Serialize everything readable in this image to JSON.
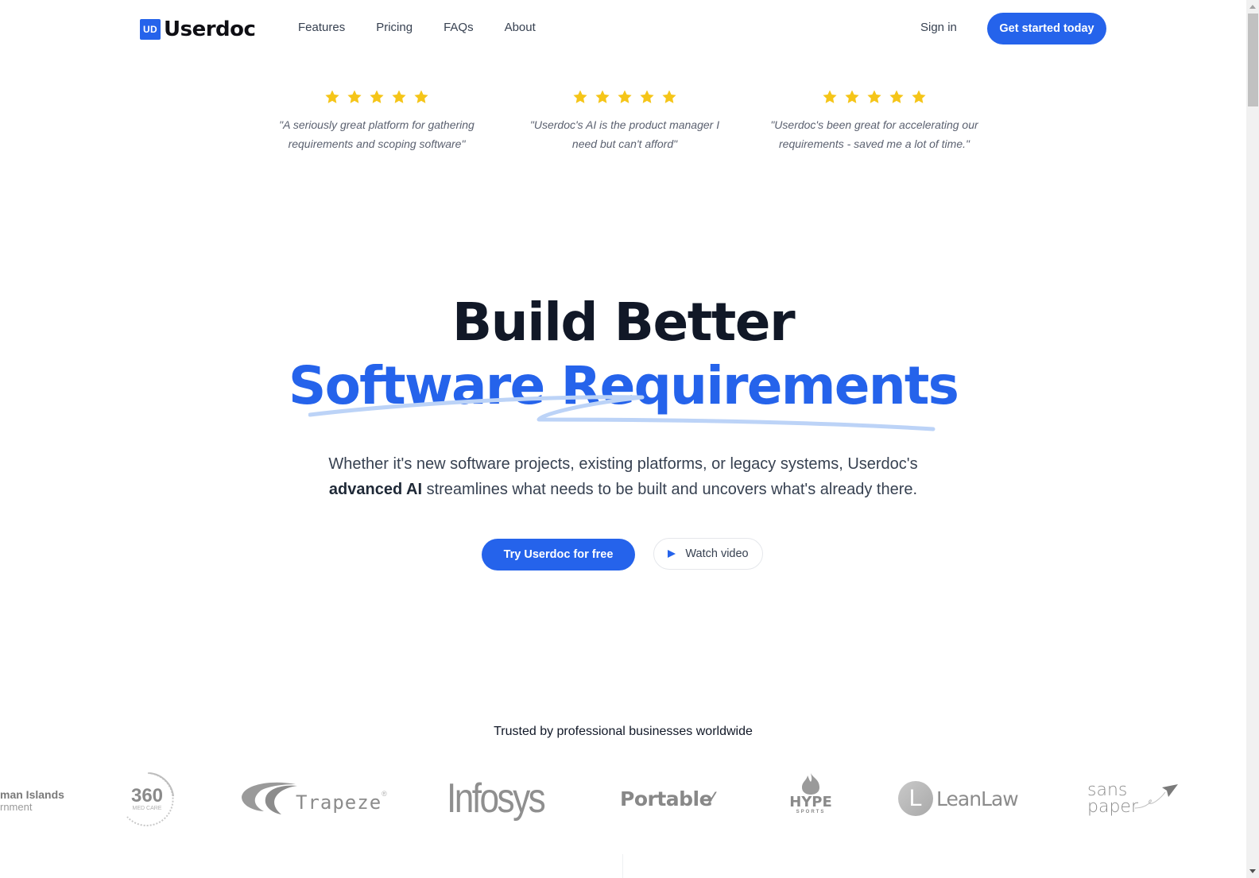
{
  "header": {
    "logo_badge": "UD",
    "logo_text": "Userdoc",
    "nav": [
      {
        "label": "Features"
      },
      {
        "label": "Pricing"
      },
      {
        "label": "FAQs"
      },
      {
        "label": "About"
      }
    ],
    "sign_in": "Sign in",
    "cta": "Get started today"
  },
  "testimonials": [
    {
      "rating": 5,
      "quote": "\"A seriously great platform for gathering requirements and scoping software\""
    },
    {
      "rating": 5,
      "quote": "\"Userdoc's AI is the product manager I need but can't afford\""
    },
    {
      "rating": 5,
      "quote": "\"Userdoc's been great for accelerating our requirements - saved me a lot of time.\""
    }
  ],
  "hero": {
    "title_line1": "Build Better",
    "title_line2": "Software Requirements",
    "subtitle_part1": "Whether it's new software projects, existing platforms, or legacy systems, Userdoc's",
    "subtitle_bold": "advanced AI",
    "subtitle_part2": "streamlines what needs to be built and uncovers what's already there.",
    "primary_button": "Try Userdoc for free",
    "video_button": "Watch video"
  },
  "trusted": {
    "heading": "Trusted by professional businesses worldwide",
    "logos": [
      {
        "name": "Cayman Islands Government",
        "line1": "man Islands",
        "line2": "rnment"
      },
      {
        "name": "360 Med Care",
        "main": "360",
        "sub": "MED CARE"
      },
      {
        "name": "Trapeze",
        "text": "Trapeze"
      },
      {
        "name": "Infosys",
        "text": "Infosys"
      },
      {
        "name": "Portable",
        "text": "Portable"
      },
      {
        "name": "Hype Sports",
        "main": "HYPE",
        "sub": "SPORTS"
      },
      {
        "name": "LeanLaw",
        "badge": "L",
        "text": "LeanLaw"
      },
      {
        "name": "Sans Paper",
        "line1": "sans",
        "line2": "paper"
      }
    ]
  },
  "colors": {
    "brand": "#2563eb",
    "star": "#f5c518",
    "heading": "#111827",
    "logo_gray": "#8f8f8f"
  }
}
